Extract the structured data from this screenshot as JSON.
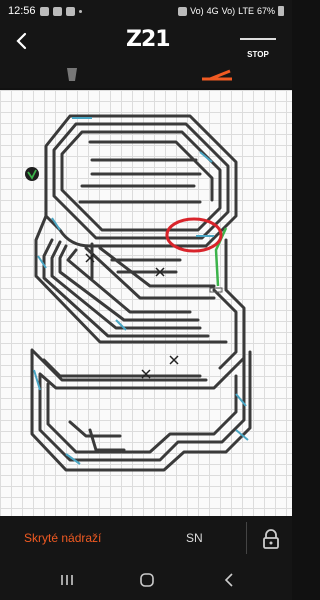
{
  "status_bar": {
    "time": "12:56",
    "network_labels": [
      "Vo)",
      "4G",
      "Vo)",
      "LTE"
    ],
    "battery": "67%"
  },
  "header": {
    "app_logo": "Z21",
    "stop_label": "STOP"
  },
  "tabs": [
    {
      "name": "signals-tab",
      "icon": "signal-icon",
      "active": false
    },
    {
      "name": "turnouts-tab",
      "icon": "turnout-icon",
      "active": true
    }
  ],
  "footer": {
    "hidden_station_label": "Skryté nádraží",
    "sn_label": "SN",
    "lock_icon": "lock-icon"
  },
  "colors": {
    "accent": "#f05a22",
    "track": "#3a3a3a",
    "track_section": "#4aa6c4",
    "active_route": "#3bb34a",
    "highlight_circle": "#d9242b",
    "bar_background": "#151515",
    "map_background": "#fafafa"
  },
  "nav": [
    "recents",
    "home",
    "back"
  ]
}
